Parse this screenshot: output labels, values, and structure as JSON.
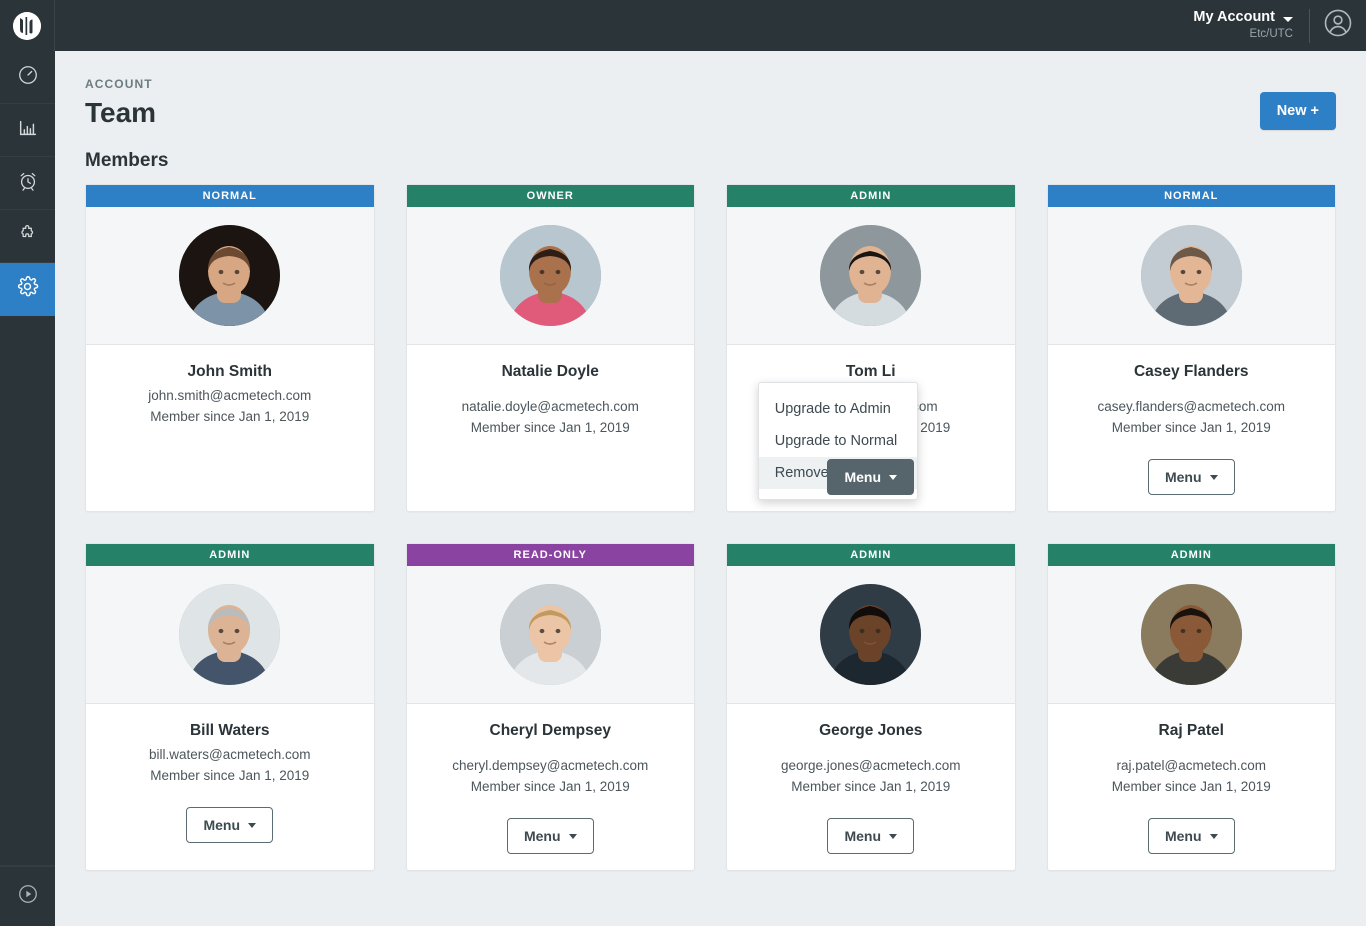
{
  "topbar": {
    "logo_icon": "app-logo-icon",
    "account_label": "My Account",
    "timezone": "Etc/UTC",
    "caret_icon": "chevron-down-icon",
    "avatar_icon": "user-circle-icon"
  },
  "sidebar": {
    "items": [
      {
        "icon": "speedometer-icon",
        "name": "dashboard",
        "active": false
      },
      {
        "icon": "bar-chart-icon",
        "name": "reports",
        "active": false
      },
      {
        "icon": "alarm-clock-icon",
        "name": "alerts",
        "active": false
      },
      {
        "icon": "puzzle-piece-icon",
        "name": "integrations",
        "active": false
      },
      {
        "icon": "gear-icon",
        "name": "settings",
        "active": true
      }
    ],
    "bottom": {
      "icon": "play-circle-icon",
      "name": "help"
    }
  },
  "page": {
    "eyebrow": "ACCOUNT",
    "title": "Team",
    "new_button": "New +",
    "section_title": "Members"
  },
  "colors": {
    "accent_blue": "#2d80c6",
    "green": "#258268",
    "purple": "#8a43a0",
    "dark": "#2b3438",
    "page_bg": "#eceff1"
  },
  "menu_button_label": "Menu",
  "dropdown": {
    "items": [
      {
        "label": "Upgrade to Admin",
        "highlight": false
      },
      {
        "label": "Upgrade to Normal",
        "highlight": false
      },
      {
        "label": "Remove User",
        "highlight": true
      }
    ]
  },
  "members": [
    {
      "badge": "NORMAL",
      "badge_class": "badge-normal",
      "name": "John Smith",
      "email": "john.smith@acmetech.com",
      "since": "Member since Jan 1, 2019",
      "has_menu": false,
      "menu_open": false,
      "tight": true,
      "avatar": {
        "bg": "#1b1410",
        "skin": "#d7a783",
        "hair": "#6b4a31",
        "shirt": "#7d94a8"
      }
    },
    {
      "badge": "OWNER",
      "badge_class": "badge-owner",
      "name": "Natalie Doyle",
      "email": "natalie.doyle@acmetech.com",
      "since": "Member since Jan 1, 2019",
      "has_menu": false,
      "menu_open": false,
      "tight": false,
      "avatar": {
        "bg": "#b8c7cf",
        "skin": "#a9714c",
        "hair": "#2e1d14",
        "shirt": "#e05a7a"
      }
    },
    {
      "badge": "ADMIN",
      "badge_class": "badge-admin",
      "name": "Tom Li",
      "email": "tom.li@acmetech.com",
      "since": "Member since Jan 1, 2019",
      "has_menu": true,
      "menu_open": true,
      "tight": false,
      "avatar": {
        "bg": "#8d979c",
        "skin": "#e0b392",
        "hair": "#191513",
        "shirt": "#d4dce0"
      }
    },
    {
      "badge": "NORMAL",
      "badge_class": "badge-normal",
      "name": "Casey Flanders",
      "email": "casey.flanders@acmetech.com",
      "since": "Member since Jan 1, 2019",
      "has_menu": true,
      "menu_open": false,
      "tight": false,
      "avatar": {
        "bg": "#c3ccd2",
        "skin": "#e3b795",
        "hair": "#6d5947",
        "shirt": "#5e6a74"
      }
    },
    {
      "badge": "ADMIN",
      "badge_class": "badge-admin",
      "name": "Bill Waters",
      "email": "bill.waters@acmetech.com",
      "since": "Member since Jan 1, 2019",
      "has_menu": true,
      "menu_open": false,
      "tight": true,
      "avatar": {
        "bg": "#dfe4e7",
        "skin": "#dcb394",
        "hair": "#b9bcbe",
        "shirt": "#44546a"
      }
    },
    {
      "badge": "READ-ONLY",
      "badge_class": "badge-readonly",
      "name": "Cheryl Dempsey",
      "email": "cheryl.dempsey@acmetech.com",
      "since": "Member since Jan 1, 2019",
      "has_menu": true,
      "menu_open": false,
      "tight": false,
      "avatar": {
        "bg": "#c9cfd2",
        "skin": "#ecc4a6",
        "hair": "#c09a5e",
        "shirt": "#e4e7ea"
      }
    },
    {
      "badge": "ADMIN",
      "badge_class": "badge-admin",
      "name": "George Jones",
      "email": "george.jones@acmetech.com",
      "since": "Member since Jan 1, 2019",
      "has_menu": true,
      "menu_open": false,
      "tight": false,
      "avatar": {
        "bg": "#2f3b45",
        "skin": "#6b4328",
        "hair": "#120d0a",
        "shirt": "#1d2730"
      }
    },
    {
      "badge": "ADMIN",
      "badge_class": "badge-admin",
      "name": "Raj Patel",
      "email": "raj.patel@acmetech.com",
      "since": "Member since Jan 1, 2019",
      "has_menu": true,
      "menu_open": false,
      "tight": false,
      "avatar": {
        "bg": "#8a7a5e",
        "skin": "#8a5a38",
        "hair": "#1a120c",
        "shirt": "#3a3b37"
      }
    }
  ]
}
